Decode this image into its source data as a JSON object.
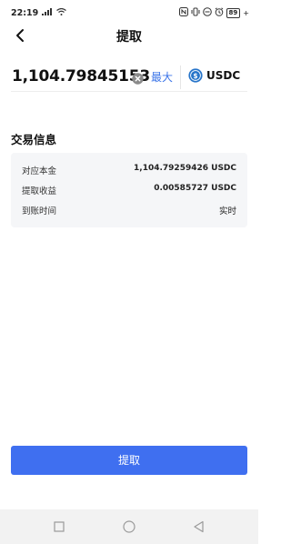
{
  "status_bar": {
    "time": "22:19",
    "signal_text": ".ıl",
    "battery": "89"
  },
  "header": {
    "title": "提取"
  },
  "amount": {
    "value": "1,104.79845153",
    "max_label": "最大",
    "token": "USDC"
  },
  "section": {
    "title": "交易信息"
  },
  "info": {
    "rows": [
      {
        "label": "对应本金",
        "value": "1,104.79259426 USDC"
      },
      {
        "label": "提取收益",
        "value": "0.00585727 USDC"
      },
      {
        "label": "到账时间",
        "value": "实时"
      }
    ]
  },
  "actions": {
    "submit_label": "提取"
  },
  "colors": {
    "accent": "#3f6ff0",
    "link": "#3b74e8",
    "card_bg": "#f5f6f8",
    "usdc_icon": "#2775ca"
  }
}
